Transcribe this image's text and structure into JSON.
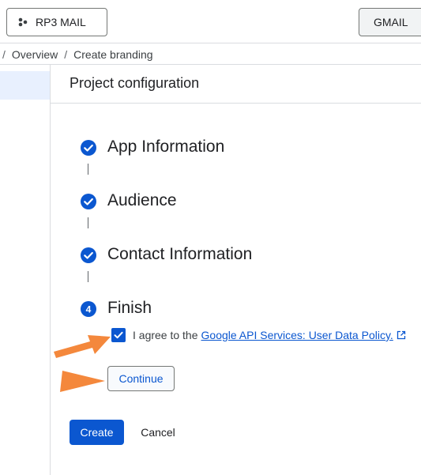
{
  "header": {
    "project_button": {
      "label": "RP3 MAIL",
      "icon": "project-dots-icon"
    },
    "gmail_button": {
      "label": "GMAIL"
    }
  },
  "breadcrumb": {
    "separator": "/",
    "items": [
      "Overview",
      "Create branding"
    ]
  },
  "section": {
    "title": "Project configuration"
  },
  "steps": [
    {
      "label": "App Information",
      "status": "completed",
      "icon": "check-circle-icon"
    },
    {
      "label": "Audience",
      "status": "completed",
      "icon": "check-circle-icon"
    },
    {
      "label": "Contact Information",
      "status": "completed",
      "icon": "check-circle-icon"
    },
    {
      "label": "Finish",
      "status": "current",
      "number": "4"
    }
  ],
  "agreement": {
    "checked": true,
    "text": "I agree to the",
    "link_text": "Google API Services: User Data Policy.",
    "link_icon": "open-in-new-icon"
  },
  "buttons": {
    "continue": "Continue",
    "create": "Create",
    "cancel": "Cancel"
  },
  "colors": {
    "primary": "#0b57d0",
    "annotation_arrow": "#f4883c",
    "nav_selected": "#e8f0fe"
  },
  "annotations": [
    {
      "type": "arrow",
      "points_to": "agreement-checkbox"
    },
    {
      "type": "arrow",
      "points_to": "continue-button"
    }
  ]
}
